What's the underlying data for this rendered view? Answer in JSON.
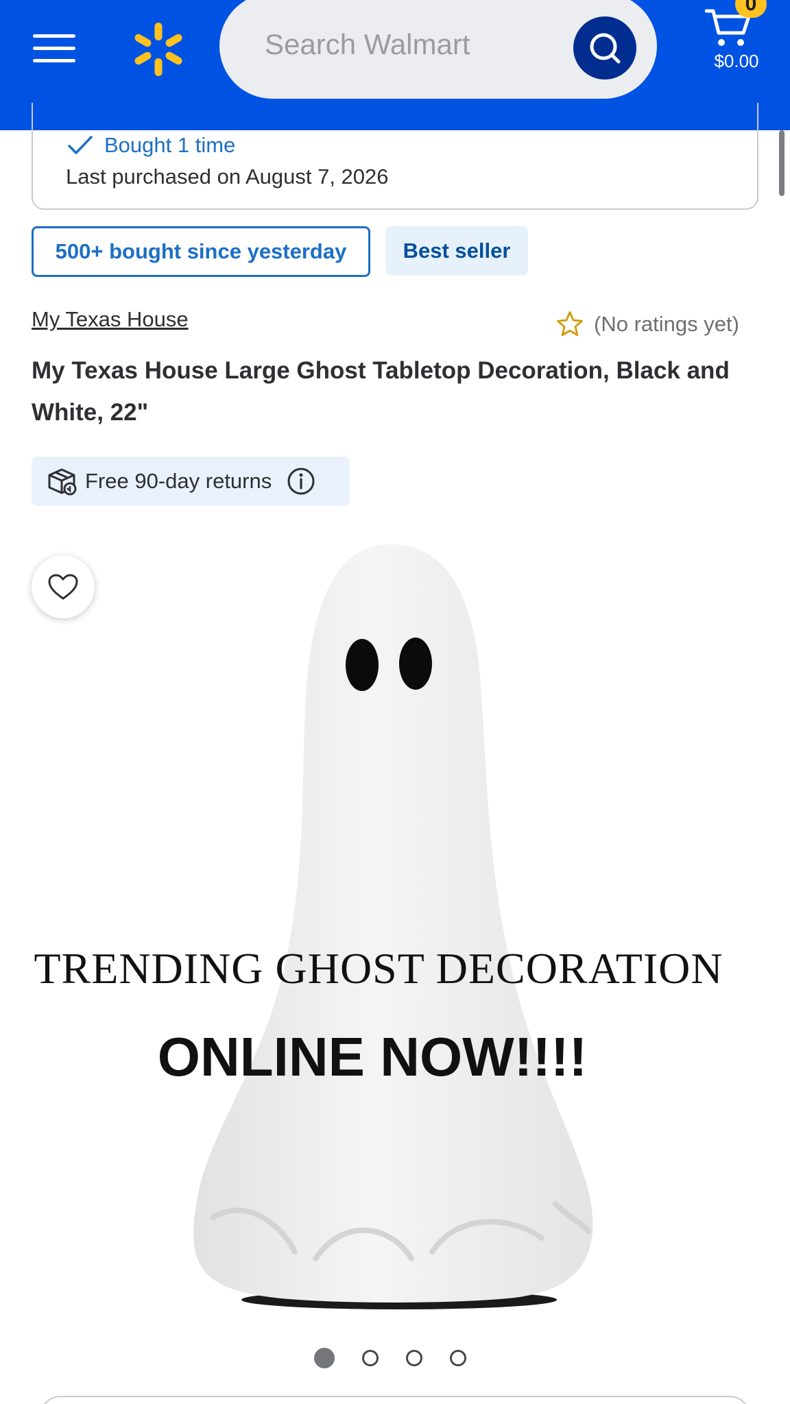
{
  "header": {
    "search_placeholder": "Search Walmart",
    "cart_count": "0",
    "cart_total": "$0.00",
    "brand_color": "#0053e2",
    "spark_color": "#ffc220"
  },
  "purchase_history": {
    "bought_label": "Bought 1 time",
    "last_purchased": "Last purchased on August 7, 2026"
  },
  "badges": {
    "popularity": "500+ bought since yesterday",
    "best_seller": "Best seller"
  },
  "product": {
    "brand": "My Texas House",
    "rating_text": "(No ratings yet)",
    "title": "My Texas House Large Ghost Tabletop Decoration, Black and White, 22\"",
    "returns": "Free 90-day returns"
  },
  "image_overlay": {
    "line1": "TRENDING GHOST DECORATION",
    "line2": "ONLINE NOW!!!!"
  },
  "carousel": {
    "total_images": 4,
    "active_index": 0
  },
  "icons": [
    "menu-icon",
    "walmart-spark-logo",
    "search-icon",
    "cart-icon",
    "checkmark-icon",
    "star-outline-icon",
    "return-box-icon",
    "info-icon",
    "heart-icon"
  ]
}
